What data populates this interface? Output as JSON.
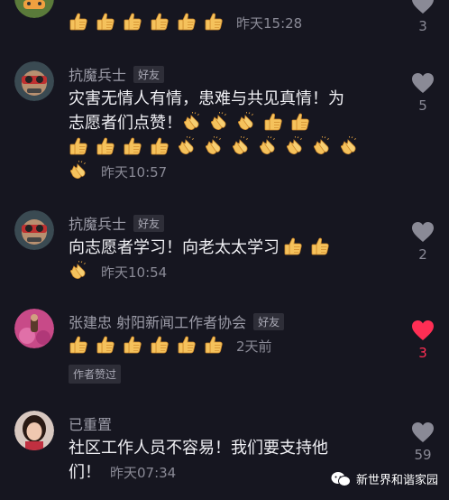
{
  "comments": [
    {
      "id": "c0",
      "name": "",
      "badge": "",
      "lines": [],
      "time": "昨天15:28",
      "likes": "3",
      "liked": false
    },
    {
      "id": "c1",
      "name": "抗魔兵士",
      "badge": "好友",
      "line1": "灾害无情人有情，患难与共见真情！为",
      "line2_text": "志愿者们点赞！",
      "time": "昨天10:57",
      "likes": "5",
      "liked": false
    },
    {
      "id": "c2",
      "name": "抗魔兵士",
      "badge": "好友",
      "line1_text": "向志愿者学习！向老太太学习",
      "time": "昨天10:54",
      "likes": "2",
      "liked": false
    },
    {
      "id": "c3",
      "name": "张建忠 射阳新闻工作者协会",
      "badge": "好友",
      "time": "2天前",
      "author_liked": "作者赞过",
      "likes": "3",
      "liked": true
    },
    {
      "id": "c4",
      "name": "已重置",
      "line1": "社区工作人员不容易！我们要支持他",
      "line2_text": "们！",
      "time": "昨天07:34",
      "likes": "59",
      "liked": false
    }
  ],
  "watermark": "新世界和谐家园",
  "emoji_names": {
    "thumbs": "thumbs-up-emoji",
    "clap": "clapping-hands-emoji"
  },
  "colors": {
    "background": "#161620",
    "liked_heart": "#ff2e54",
    "heart": "#8a8a96"
  }
}
